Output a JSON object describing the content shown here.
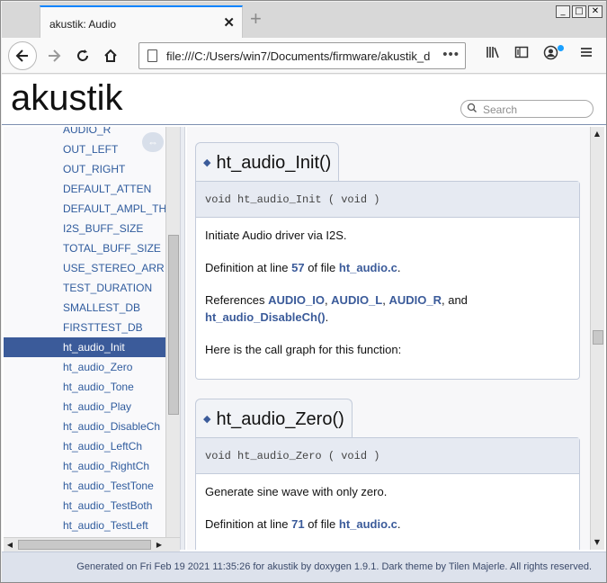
{
  "browser": {
    "tab_title": "akustik: Audio",
    "tab_close": "✕",
    "new_tab": "+",
    "url": "file:///C:/Users/win7/Documents/firmware/akustik_d",
    "url_more": "•••",
    "window_buttons": [
      "_",
      "□",
      "✕"
    ]
  },
  "header": {
    "brand": "akustik",
    "search_placeholder": "Search"
  },
  "sidebar": {
    "items": [
      {
        "label": "AUDIO_R"
      },
      {
        "label": "OUT_LEFT"
      },
      {
        "label": "OUT_RIGHT"
      },
      {
        "label": "DEFAULT_ATTEN"
      },
      {
        "label": "DEFAULT_AMPL_TH"
      },
      {
        "label": "I2S_BUFF_SIZE"
      },
      {
        "label": "TOTAL_BUFF_SIZE"
      },
      {
        "label": "USE_STEREO_ARR"
      },
      {
        "label": "TEST_DURATION"
      },
      {
        "label": "SMALLEST_DB"
      },
      {
        "label": "FIRSTTEST_DB"
      },
      {
        "label": "ht_audio_Init"
      },
      {
        "label": "ht_audio_Zero"
      },
      {
        "label": "ht_audio_Tone"
      },
      {
        "label": "ht_audio_Play"
      },
      {
        "label": "ht_audio_DisableCh"
      },
      {
        "label": "ht_audio_LeftCh"
      },
      {
        "label": "ht_audio_RightCh"
      },
      {
        "label": "ht_audio_TestTone"
      },
      {
        "label": "ht_audio_TestBoth"
      },
      {
        "label": "ht_audio_TestLeft"
      }
    ],
    "selected": "ht_audio_Init"
  },
  "content": {
    "init": {
      "title": "ht_audio_Init()",
      "proto": "void ht_audio_Init ( void   )",
      "desc": "Initiate Audio driver via I2S.",
      "def_pre": "Definition at line ",
      "def_line": "57",
      "def_mid": " of file ",
      "def_file": "ht_audio.c",
      "def_post": ".",
      "refs_pre": "References ",
      "ref1": "AUDIO_IO",
      "sep1": ", ",
      "ref2": "AUDIO_L",
      "sep2": ", ",
      "ref3": "AUDIO_R",
      "sep3": ", and ",
      "ref4": "ht_audio_DisableCh()",
      "refs_post": ".",
      "callgraph": "Here is the call graph for this function:"
    },
    "zero": {
      "title": "ht_audio_Zero()",
      "proto": "void ht_audio_Zero ( void   )",
      "desc": "Generate sine wave with only zero.",
      "def_pre": "Definition at line ",
      "def_line": "71",
      "def_mid": " of file ",
      "def_file": "ht_audio.c",
      "def_post": "."
    }
  },
  "footer": {
    "text": "Generated on Fri Feb 19 2021 11:35:26 for akustik by doxygen 1.9.1. Dark theme by Tilen Majerle. All rights reserved."
  }
}
